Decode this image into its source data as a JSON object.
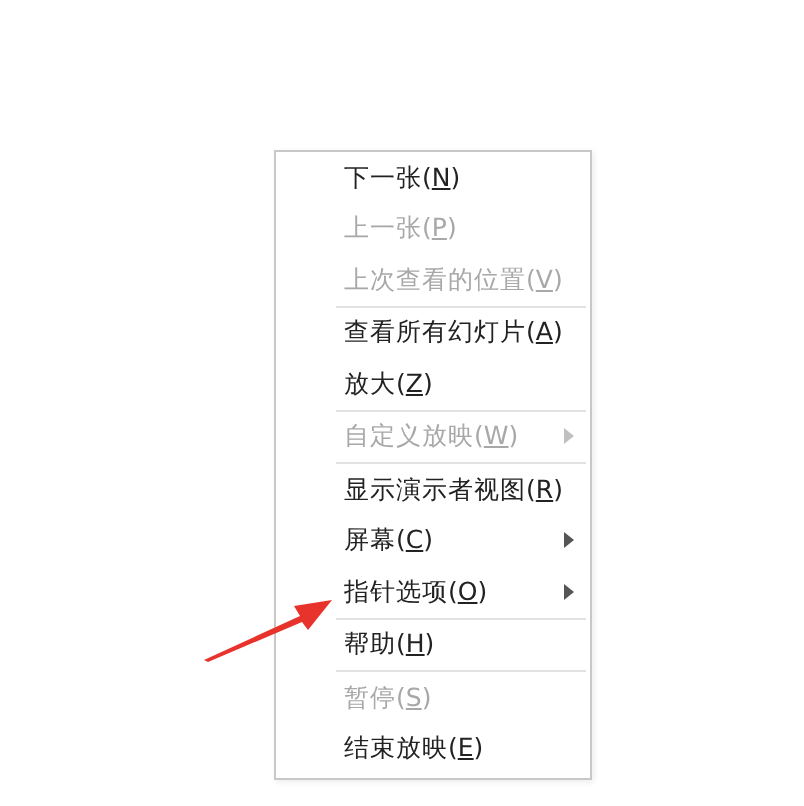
{
  "context_menu": {
    "items": [
      {
        "kind": "item",
        "label": "下一张(N)",
        "disabled": false,
        "submenu": false
      },
      {
        "kind": "item",
        "label": "上一张(P)",
        "disabled": true,
        "submenu": false
      },
      {
        "kind": "item",
        "label": "上次查看的位置(V)",
        "disabled": true,
        "submenu": false
      },
      {
        "kind": "separator"
      },
      {
        "kind": "item",
        "label": "查看所有幻灯片(A)",
        "disabled": false,
        "submenu": false
      },
      {
        "kind": "item",
        "label": "放大(Z)",
        "disabled": false,
        "submenu": false
      },
      {
        "kind": "separator"
      },
      {
        "kind": "item",
        "label": "自定义放映(W)",
        "disabled": true,
        "submenu": true
      },
      {
        "kind": "separator"
      },
      {
        "kind": "item",
        "label": "显示演示者视图(R)",
        "disabled": false,
        "submenu": false
      },
      {
        "kind": "item",
        "label": "屏幕(C)",
        "disabled": false,
        "submenu": true
      },
      {
        "kind": "item",
        "label": "指针选项(O)",
        "disabled": false,
        "submenu": true
      },
      {
        "kind": "separator"
      },
      {
        "kind": "item",
        "label": "帮助(H)",
        "disabled": false,
        "submenu": false
      },
      {
        "kind": "separator"
      },
      {
        "kind": "item",
        "label": "暂停(S)",
        "disabled": true,
        "submenu": false
      },
      {
        "kind": "item",
        "label": "结束放映(E)",
        "disabled": false,
        "submenu": false
      }
    ]
  }
}
